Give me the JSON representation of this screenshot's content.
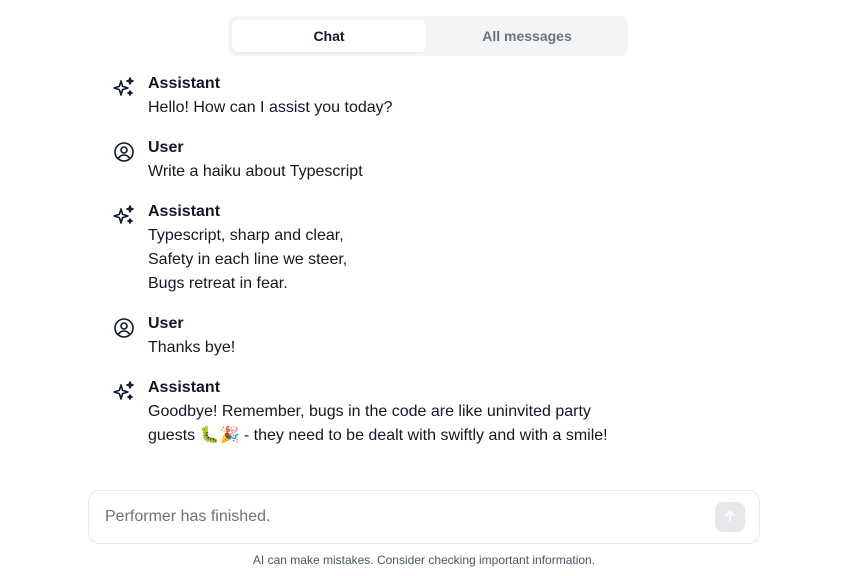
{
  "tabs": [
    {
      "label": "Chat",
      "active": true
    },
    {
      "label": "All messages",
      "active": false
    }
  ],
  "messages": [
    {
      "role": "Assistant",
      "icon": "sparkles-icon",
      "text": "Hello! How can I assist you today?"
    },
    {
      "role": "User",
      "icon": "user-circle-icon",
      "text": "Write a haiku about Typescript"
    },
    {
      "role": "Assistant",
      "icon": "sparkles-icon",
      "text": "Typescript, sharp and clear,\nSafety in each line we steer,\nBugs retreat in fear."
    },
    {
      "role": "User",
      "icon": "user-circle-icon",
      "text": "Thanks bye!"
    },
    {
      "role": "Assistant",
      "icon": "sparkles-icon",
      "text": "Goodbye! Remember, bugs in the code are like uninvited party\nguests 🐛🎉 - they need to be dealt with swiftly and with a smile!"
    }
  ],
  "composer": {
    "placeholder": "Performer has finished.",
    "value": "",
    "send_icon": "arrow-up-icon"
  },
  "disclaimer": "AI can make mistakes. Consider checking important information.",
  "colors": {
    "tab_bg": "#f3f4f6",
    "send_button_bg": "#e5e7eb",
    "text": "#111827",
    "muted": "#6b7280"
  }
}
